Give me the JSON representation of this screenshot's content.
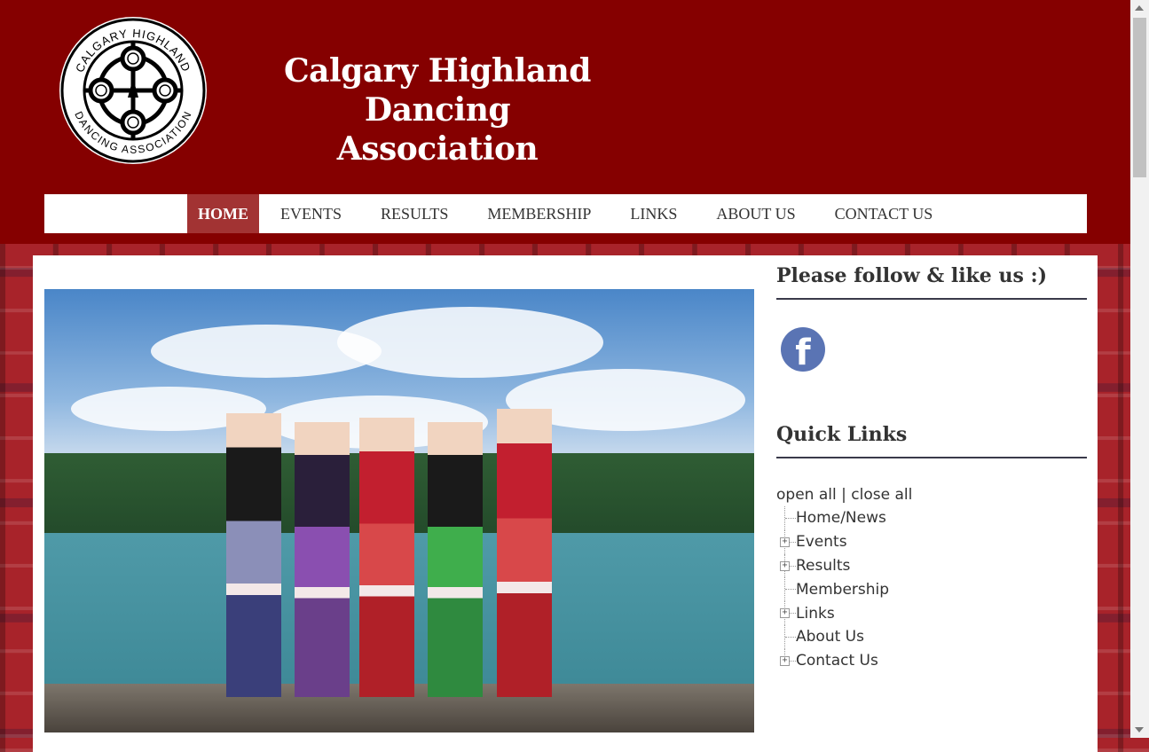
{
  "site": {
    "title_line1": "Calgary Highland Dancing",
    "title_line2": "Association",
    "logo_text_top": "CALGARY HIGHLAND",
    "logo_text_bottom": "DANCING ASSOCIATION"
  },
  "nav": {
    "items": [
      {
        "label": "HOME",
        "active": true
      },
      {
        "label": "EVENTS"
      },
      {
        "label": "RESULTS"
      },
      {
        "label": "MEMBERSHIP"
      },
      {
        "label": "LINKS"
      },
      {
        "label": "ABOUT US"
      },
      {
        "label": "CONTACT US"
      }
    ]
  },
  "sidebar": {
    "follow_title": "Please follow & like us :)",
    "facebook_glyph": "f",
    "quick_links_title": "Quick Links",
    "open_all": "open all",
    "separator": "|",
    "close_all": "close all",
    "links": [
      {
        "label": "Home/News",
        "expandable": false
      },
      {
        "label": "Events",
        "expandable": true
      },
      {
        "label": "Results",
        "expandable": true
      },
      {
        "label": "Membership",
        "expandable": false
      },
      {
        "label": "Links",
        "expandable": true
      },
      {
        "label": "About Us",
        "expandable": false
      },
      {
        "label": "Contact Us",
        "expandable": true
      }
    ]
  },
  "colors": {
    "header_bg": "#850000",
    "nav_active_bg": "#a23333",
    "facebook_blue": "#5a74b4"
  }
}
